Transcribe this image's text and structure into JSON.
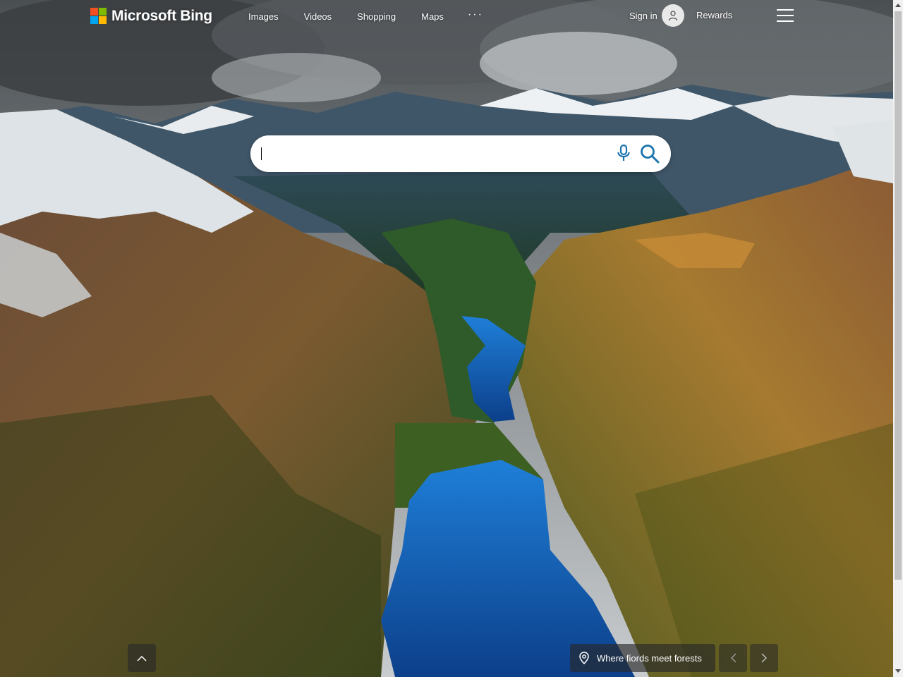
{
  "brand": {
    "name": "Microsoft Bing",
    "logo_colors": [
      "#f25022",
      "#7fba00",
      "#00a4ef",
      "#ffb900"
    ]
  },
  "nav": {
    "items": [
      {
        "label": "Images"
      },
      {
        "label": "Videos"
      },
      {
        "label": "Shopping"
      },
      {
        "label": "Maps"
      }
    ],
    "more_label": "···"
  },
  "account": {
    "signin_label": "Sign in",
    "rewards_label": "Rewards"
  },
  "search": {
    "value": "",
    "placeholder": ""
  },
  "background": {
    "caption": "Where fiords meet forests"
  },
  "icons": {
    "menu": "hamburger-icon",
    "mic": "microphone-icon",
    "search": "search-icon",
    "location": "location-pin-icon",
    "scroll_up": "chevron-up-icon",
    "prev": "chevron-left-icon",
    "next": "chevron-right-icon"
  },
  "colors": {
    "accent": "#007daa",
    "caption_bg": "#282828"
  }
}
